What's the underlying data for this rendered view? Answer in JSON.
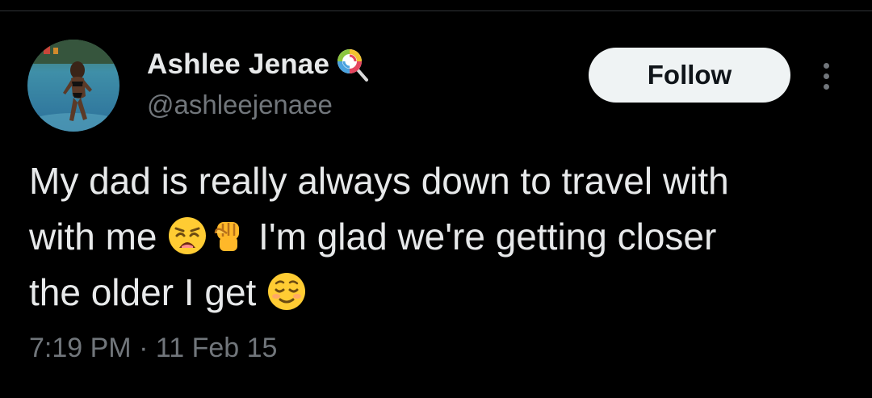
{
  "author": {
    "display_name": "Ashlee Jenae",
    "handle": "@ashleejenaee",
    "avatar_icon": "avatar-photo",
    "badge_icon": "lollipop-icon"
  },
  "actions": {
    "follow_label": "Follow",
    "more_icon": "more-options-icon"
  },
  "tweet": {
    "line1": "My dad is really always down to travel with",
    "line2_start": "with me ",
    "emoji_1": "weary-face-emoji",
    "emoji_2": "raised-fist-emoji",
    "line2_end": " I'm glad we're getting closer",
    "line3": "the older I get ",
    "emoji_3": "relieved-face-emoji"
  },
  "meta": {
    "timestamp": "7:19 PM · 11 Feb 15"
  },
  "colors": {
    "background": "#000000",
    "text_primary": "#e7e9ea",
    "text_secondary": "#71767b",
    "follow_bg": "#eff3f4",
    "follow_text": "#0f1419"
  }
}
